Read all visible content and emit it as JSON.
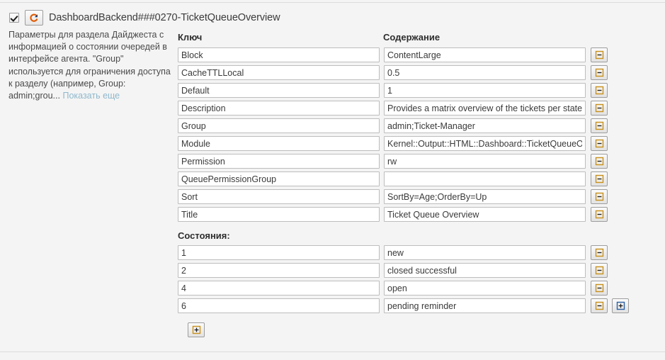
{
  "header": {
    "enabled_checkbox": true,
    "reset_icon": "reset-circular-arrow-icon",
    "title": "DashboardBackend###0270-TicketQueueOverview"
  },
  "description": {
    "text": "Параметры для раздела Дайджеста с информацией о состоянии очередей в интерфейсе агента. \"Group\" используется для ограничения доступа к разделу (например, Group: admin;grou...",
    "more_link": "Показать еще"
  },
  "columns": {
    "key_header": "Ключ",
    "value_header": "Содержание"
  },
  "settings_rows": [
    {
      "key": "Block",
      "value": "ContentLarge"
    },
    {
      "key": "CacheTTLLocal",
      "value": "0.5"
    },
    {
      "key": "Default",
      "value": "1"
    },
    {
      "key": "Description",
      "value": "Provides a matrix overview of the tickets per state p"
    },
    {
      "key": "Group",
      "value": "admin;Ticket-Manager"
    },
    {
      "key": "Module",
      "value": "Kernel::Output::HTML::Dashboard::TicketQueueOve"
    },
    {
      "key": "Permission",
      "value": "rw"
    },
    {
      "key": "QueuePermissionGroup",
      "value": ""
    },
    {
      "key": "Sort",
      "value": "SortBy=Age;OrderBy=Up"
    },
    {
      "key": "Title",
      "value": "Ticket Queue Overview"
    }
  ],
  "states": {
    "label": "Состояния:",
    "rows": [
      {
        "key": "1",
        "value": "new"
      },
      {
        "key": "2",
        "value": "closed successful"
      },
      {
        "key": "4",
        "value": "open"
      },
      {
        "key": "6",
        "value": "pending reminder"
      }
    ]
  },
  "icons": {
    "remove": "minus-square-icon",
    "add": "plus-square-icon"
  },
  "colors": {
    "page_background": "#f4f4f4",
    "field_border": "#bdbdbd",
    "link": "#8fb8cc",
    "remove_icon": "#c8901a",
    "add_icon_blue": "#2a5fa5",
    "add_icon_gold": "#c8901a",
    "reset_icon": "#e05a00"
  }
}
